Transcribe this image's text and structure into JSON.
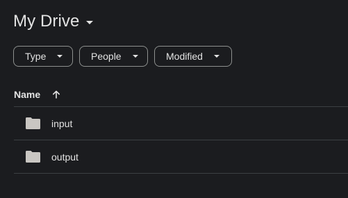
{
  "header": {
    "title": "My Drive"
  },
  "filters": [
    {
      "label": "Type"
    },
    {
      "label": "People"
    },
    {
      "label": "Modified"
    }
  ],
  "list": {
    "column_name": "Name",
    "sort": "ascending",
    "items": [
      {
        "name": "input",
        "icon": "folder-icon"
      },
      {
        "name": "output",
        "icon": "folder-icon"
      }
    ]
  },
  "colors": {
    "background": "#1b1c1f",
    "text": "#e3e3e3",
    "chip_border": "#8e918f",
    "divider": "#3c4043",
    "folder": "#c9c6c2"
  }
}
